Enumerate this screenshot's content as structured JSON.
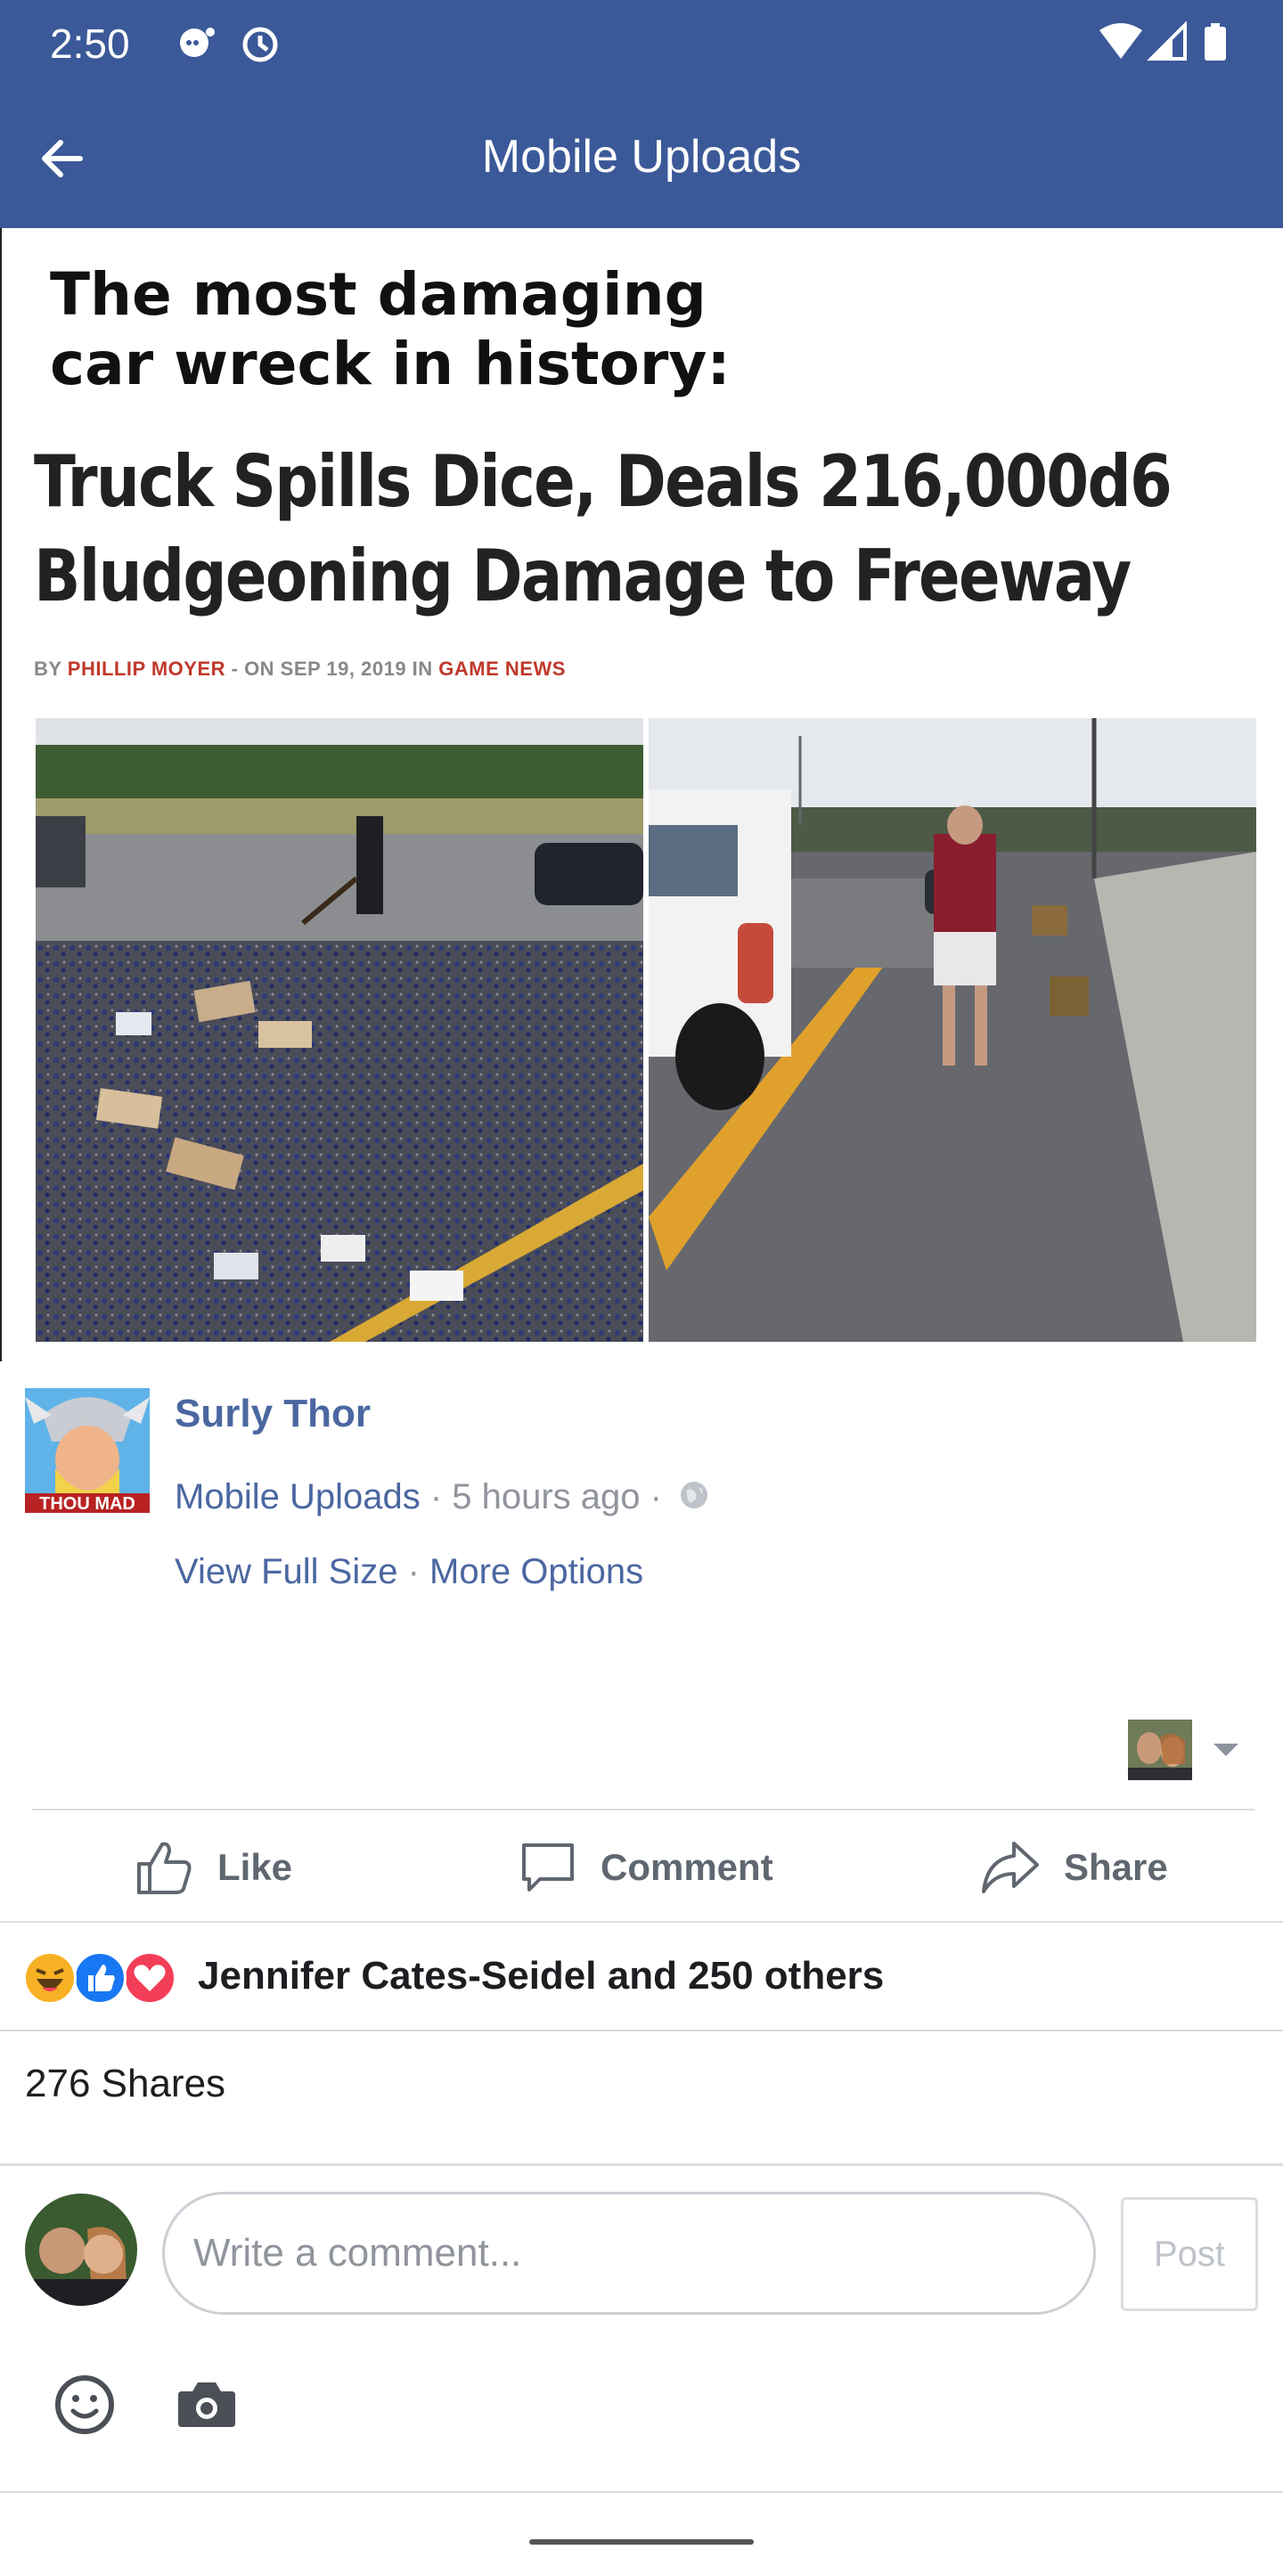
{
  "status_bar": {
    "time": "2:50",
    "icons": [
      "chat-notification-icon",
      "sync-notification-icon",
      "wifi-icon",
      "signal-icon",
      "battery-icon"
    ]
  },
  "app_bar": {
    "title": "Mobile Uploads",
    "back_icon": "arrow-left-icon"
  },
  "photo": {
    "headline_line1": "The most damaging",
    "headline_line2": "car wreck in history:",
    "article_title_line1": "Truck Spills Dice, Deals 216,000d6",
    "article_title_line2": "Bludgeoning Damage to Freeway",
    "byline_prefix": "BY ",
    "byline_author": "PHILLIP MOYER",
    "byline_middle": " - ON SEP 19, 2019 IN ",
    "byline_category": "GAME NEWS",
    "avatar_caption": "THOU MAD"
  },
  "post": {
    "poster_name": "Surly Thor",
    "album_link": "Mobile Uploads",
    "separator": " · ",
    "time_ago": "5 hours ago",
    "view_full_size": "View Full Size",
    "more_options": "More Options"
  },
  "actions": {
    "like": "Like",
    "comment": "Comment",
    "share": "Share"
  },
  "reactions": {
    "types": [
      "haha",
      "like",
      "love"
    ],
    "summary": "Jennifer Cates-Seidel and 250 others"
  },
  "shares": {
    "text": "276 Shares"
  },
  "comment_composer": {
    "placeholder": "Write a comment...",
    "post_label": "Post"
  },
  "colors": {
    "brand": "#3b5998",
    "link": "#4b67a1",
    "muted": "#90949c",
    "like_blue": "#1877f2",
    "love_red": "#f33e58",
    "haha_yellow": "#f7b125"
  }
}
